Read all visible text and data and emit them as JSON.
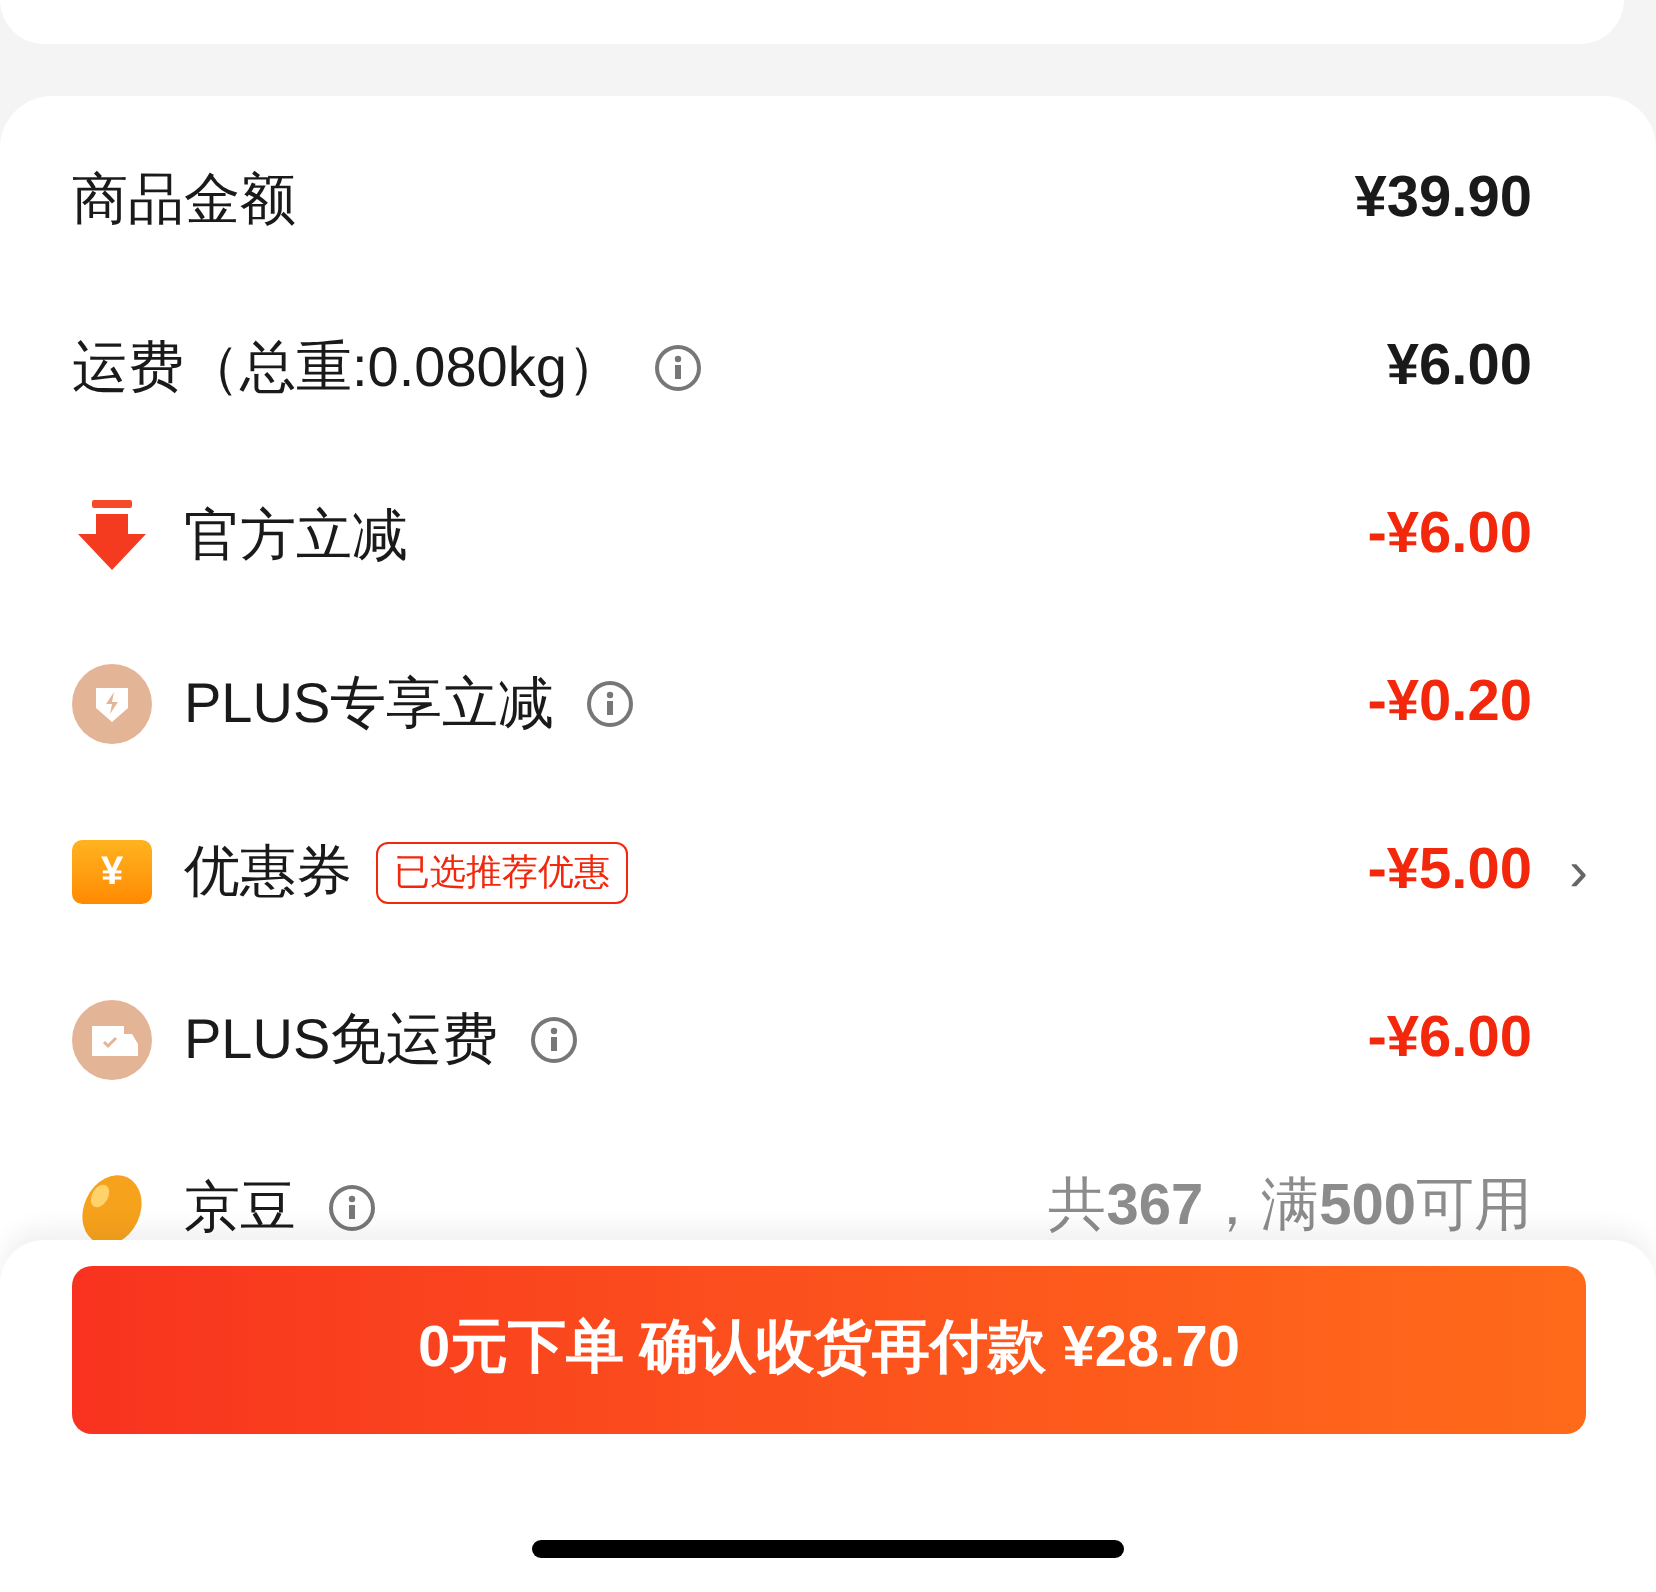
{
  "rows": [
    {
      "kind": "plain",
      "label": "商品金额",
      "info": false,
      "value": "¥39.90",
      "color": "#1a1a1a",
      "chevron": false
    },
    {
      "kind": "plain",
      "label": "运费（总重:0.080kg）",
      "info": true,
      "value": "¥6.00",
      "color": "#1a1a1a",
      "chevron": false
    },
    {
      "kind": "arrow",
      "label": "官方立减",
      "info": false,
      "value": "-¥6.00",
      "color": "#f2270c",
      "chevron": false
    },
    {
      "kind": "badge",
      "label": "PLUS专享立减",
      "info": true,
      "value": "-¥0.20",
      "color": "#f2270c",
      "chevron": false
    },
    {
      "kind": "coupon",
      "icon_text": "¥",
      "label": "优惠券",
      "tag": "已选推荐优惠",
      "info": false,
      "value": "-¥5.00",
      "color": "#f2270c",
      "chevron": true,
      "chevron_text": "›"
    },
    {
      "kind": "truck",
      "label": "PLUS免运费",
      "info": true,
      "value": "-¥6.00",
      "color": "#f2270c",
      "chevron": false
    },
    {
      "kind": "bean",
      "label": "京豆",
      "info": true,
      "value": "共**367**，满**500**可用",
      "color": "#8c8c8c",
      "chevron": false
    }
  ],
  "submit_button": "0元下单 确认收货再付款 ¥28.70"
}
